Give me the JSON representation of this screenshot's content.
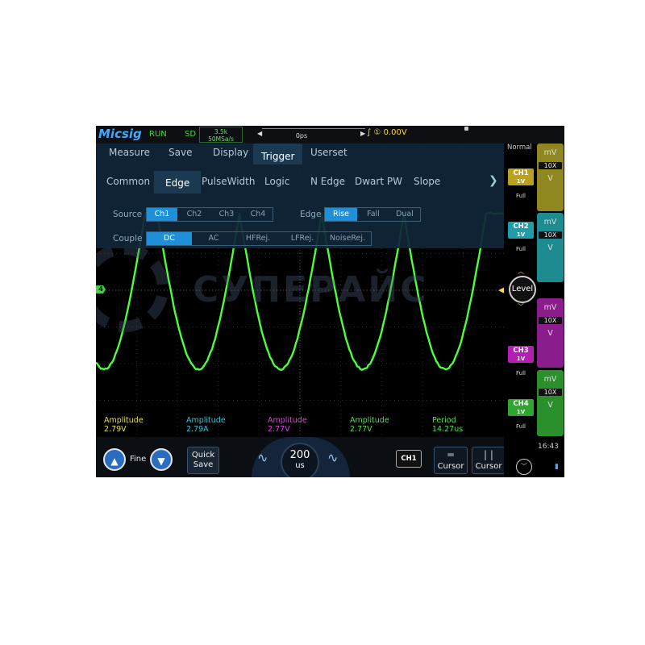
{
  "topbar": {
    "brand": "Micsig",
    "run": "RUN",
    "storage": "SD",
    "mem_depth": "3.5k",
    "sample_rate": "50MSa/s",
    "time_offset": "0ps",
    "trigger_level": "0.00V"
  },
  "menu": {
    "tabs": [
      {
        "label": "Measure"
      },
      {
        "label": "Save"
      },
      {
        "label": "Display"
      },
      {
        "label": "Trigger"
      },
      {
        "label": "Userset"
      }
    ],
    "active_tab": "Trigger",
    "subtabs": [
      {
        "label": "Common"
      },
      {
        "label": "Edge"
      },
      {
        "label": "PulseWidth"
      },
      {
        "label": "Logic"
      },
      {
        "label": "N Edge"
      },
      {
        "label": "Dwart PW"
      },
      {
        "label": "Slope"
      }
    ],
    "active_subtab": "Edge",
    "next_glyph": "❯",
    "source": {
      "label": "Source",
      "options": [
        "Ch1",
        "Ch2",
        "Ch3",
        "Ch4"
      ],
      "selected": "Ch1"
    },
    "edge": {
      "label": "Edge",
      "options": [
        "Rise",
        "Fall",
        "Dual"
      ],
      "selected": "Rise"
    },
    "couple": {
      "label": "Couple",
      "options": [
        "DC",
        "AC",
        "HFRej.",
        "LFRej.",
        "NoiseRej."
      ],
      "selected": "DC"
    }
  },
  "right_panel": {
    "mode": "Normal",
    "channels": [
      {
        "name": "CH1",
        "scale": "1V",
        "bw": "Full",
        "color": "#b8a21f"
      },
      {
        "name": "CH2",
        "scale": "1V",
        "bw": "Full",
        "color": "#1f9ea8"
      },
      {
        "name": "CH3",
        "scale": "1V",
        "bw": "Full",
        "color": "#b21fb2"
      },
      {
        "name": "CH4",
        "scale": "1V",
        "bw": "Full",
        "color": "#2fa62f"
      }
    ],
    "volt_blocks": [
      {
        "unit": "mV",
        "probe": "10X",
        "v": "V",
        "color": "#8f8720"
      },
      {
        "unit": "mV",
        "probe": "10X",
        "v": "V",
        "color": "#1d8b90"
      },
      {
        "unit": "mV",
        "probe": "10X",
        "v": "V",
        "color": "#8c1d8c"
      },
      {
        "unit": "mV",
        "probe": "10X",
        "v": "V",
        "color": "#2b8f2b"
      }
    ],
    "level_label": "Level",
    "time": "16:43"
  },
  "channel_marker": "4",
  "watermark": "СУПЕРАЙС",
  "measurements": [
    {
      "label": "Amplitude",
      "value": "2.79V",
      "color": "#e8e23a"
    },
    {
      "label": "Amplitude",
      "value": "2.79A",
      "color": "#35c8d8"
    },
    {
      "label": "Amplitude",
      "value": "2.77V",
      "color": "#e043e0"
    },
    {
      "label": "Amplitude",
      "value": "2.77V",
      "color": "#52e052"
    },
    {
      "label": "Period",
      "value": "14.27us",
      "color": "#52e052"
    }
  ],
  "bottom": {
    "fine_label": "Fine",
    "quick_save_line1": "Quick",
    "quick_save_line2": "Save",
    "timebase_value": "200",
    "timebase_unit": "us",
    "channel_button": "CH1",
    "cursor1": "Cursor",
    "cursor2": "Cursor"
  },
  "colors": {
    "trace": "#4cff3a",
    "menu_bg": "#10263a",
    "accent": "#1f8fd8"
  }
}
